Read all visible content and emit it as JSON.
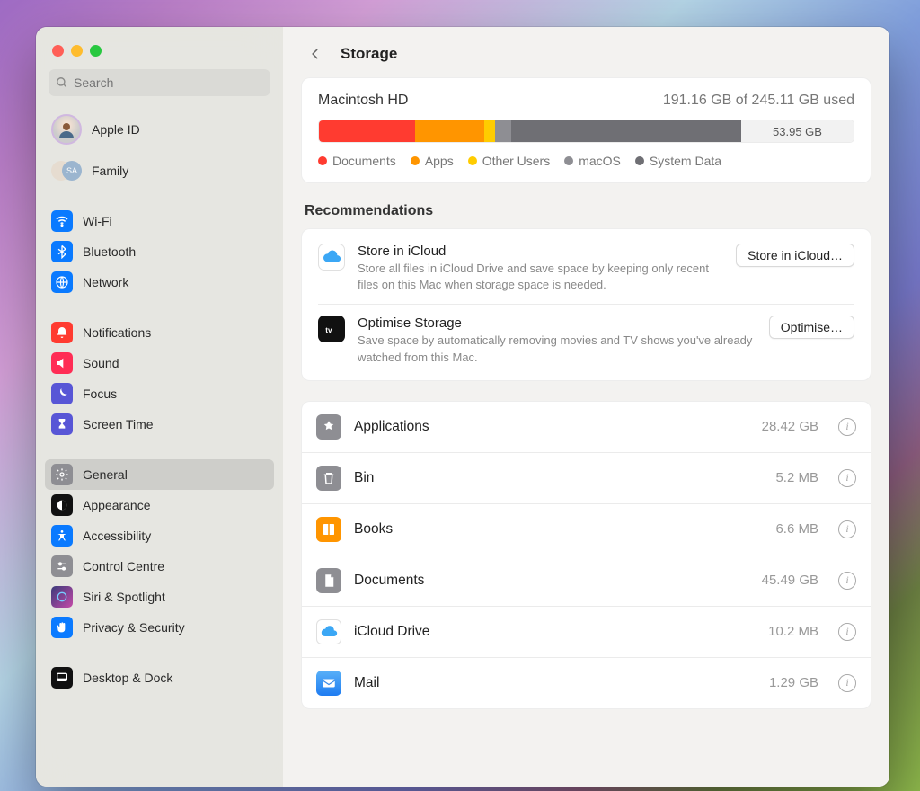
{
  "title": "Storage",
  "search_placeholder": "Search",
  "sidebar": {
    "apple_id": "Apple ID",
    "family": "Family",
    "items": [
      {
        "label": "Wi-Fi"
      },
      {
        "label": "Bluetooth"
      },
      {
        "label": "Network"
      },
      {
        "label": "Notifications"
      },
      {
        "label": "Sound"
      },
      {
        "label": "Focus"
      },
      {
        "label": "Screen Time"
      },
      {
        "label": "General"
      },
      {
        "label": "Appearance"
      },
      {
        "label": "Accessibility"
      },
      {
        "label": "Control Centre"
      },
      {
        "label": "Siri & Spotlight"
      },
      {
        "label": "Privacy & Security"
      },
      {
        "label": "Desktop & Dock"
      }
    ]
  },
  "drive": {
    "name": "Macintosh HD",
    "used_text": "191.16 GB of 245.11 GB used",
    "free_label": "53.95 GB",
    "segments": [
      {
        "label": "Documents",
        "color": "#ff3b30",
        "pct": 18
      },
      {
        "label": "Apps",
        "color": "#ff9500",
        "pct": 13
      },
      {
        "label": "Other Users",
        "color": "#ffcc00",
        "pct": 2
      },
      {
        "label": "macOS",
        "color": "#8e8e93",
        "pct": 3
      },
      {
        "label": "System Data",
        "color": "#6f6f74",
        "pct": 43
      }
    ],
    "free_pct": 21
  },
  "recommendations_label": "Recommendations",
  "recs": [
    {
      "title": "Store in iCloud",
      "desc": "Store all files in iCloud Drive and save space by keeping only recent files on this Mac when storage space is needed.",
      "btn": "Store in iCloud…"
    },
    {
      "title": "Optimise Storage",
      "desc": "Save space by automatically removing movies and TV shows you've already watched from this Mac.",
      "btn": "Optimise…"
    }
  ],
  "categories": [
    {
      "label": "Applications",
      "size": "28.42 GB"
    },
    {
      "label": "Bin",
      "size": "5.2 MB"
    },
    {
      "label": "Books",
      "size": "6.6 MB"
    },
    {
      "label": "Documents",
      "size": "45.49 GB"
    },
    {
      "label": "iCloud Drive",
      "size": "10.2 MB"
    },
    {
      "label": "Mail",
      "size": "1.29 GB"
    }
  ]
}
